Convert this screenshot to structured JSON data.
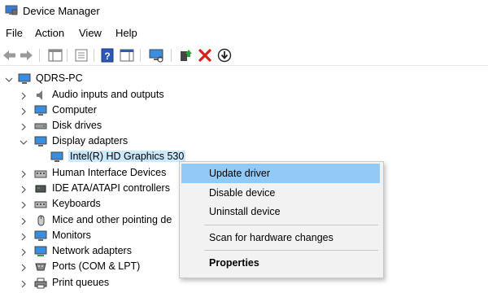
{
  "window": {
    "title": "Device Manager"
  },
  "menu": {
    "items": [
      "File",
      "Action",
      "View",
      "Help"
    ]
  },
  "toolbar": {
    "buttons": [
      "back-icon",
      "forward-icon",
      "console-tree-icon",
      "properties-icon",
      "help-icon",
      "action-pane-icon",
      "scan-hardware-icon",
      "update-driver-icon",
      "uninstall-icon",
      "disable-icon"
    ]
  },
  "tree": {
    "root": "QDRS-PC",
    "items": [
      {
        "label": "Audio inputs and outputs"
      },
      {
        "label": "Computer"
      },
      {
        "label": "Disk drives"
      },
      {
        "label": "Display adapters",
        "expanded": true
      },
      {
        "label": "Intel(R) HD Graphics 530",
        "child": true,
        "selected": true
      },
      {
        "label": "Human Interface Devices"
      },
      {
        "label": "IDE ATA/ATAPI controllers"
      },
      {
        "label": "Keyboards"
      },
      {
        "label": "Mice and other pointing de"
      },
      {
        "label": "Monitors"
      },
      {
        "label": "Network adapters"
      },
      {
        "label": "Ports (COM & LPT)"
      },
      {
        "label": "Print queues"
      }
    ]
  },
  "context_menu": {
    "items": [
      {
        "label": "Update driver",
        "highlighted": true
      },
      {
        "label": "Disable device"
      },
      {
        "label": "Uninstall device"
      },
      {
        "label": "Scan for hardware changes"
      },
      {
        "label": "Properties",
        "bold": true
      }
    ]
  },
  "colors": {
    "selection": "#cce8ff",
    "menu_highlight": "#91c9f7",
    "menu_bg": "#f2f2f2"
  }
}
